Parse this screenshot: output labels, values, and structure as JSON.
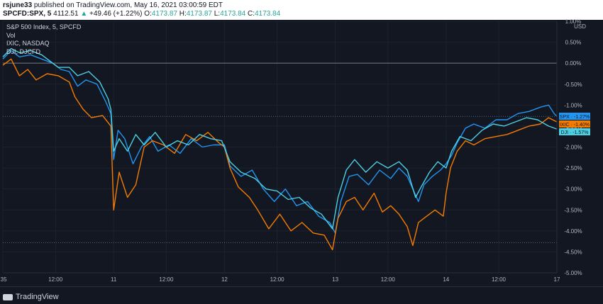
{
  "header": {
    "author": "rsjune33",
    "published": "published on TradingView.com, May 16, 2021 03:00:59 EDT",
    "symbol": "SPCFD:SPX, 5",
    "last": "4112.51",
    "change_arrow": "▲",
    "change": "+49.46 (+1.22%)",
    "o_label": "O:",
    "o": "4173.87",
    "h_label": "H:",
    "h": "4173.87",
    "l_label": "L:",
    "l": "4173.84",
    "c_label": "C:",
    "c": "4173.84"
  },
  "legend": {
    "title": "S&P 500 Index, 5, SPCFD",
    "vol": "Vol",
    "ixic": "IXIC, NASDAQ",
    "dji": "DJI, DJCFD"
  },
  "footer": {
    "brand": "TradingView"
  },
  "colors": {
    "spx": "#2196f3",
    "ixic": "#f57c00",
    "dji": "#4dd0e1",
    "bg": "#131722"
  },
  "chart_data": {
    "type": "line",
    "x_tick_labels": [
      ":35",
      "12:00",
      "11",
      "12:00",
      "12",
      "12:00",
      "13",
      "12:00",
      "14",
      "12:00",
      "17"
    ],
    "x_tick_pos": [
      0,
      0.95,
      2,
      2.95,
      4,
      4.95,
      6,
      6.95,
      8,
      8.95,
      10
    ],
    "y_unit": "USD",
    "y_ticks": [
      "1.00%",
      "0.50%",
      "0.00%",
      "-0.50%",
      "-1.00%",
      "-1.50%",
      "-2.00%",
      "-2.50%",
      "-3.00%",
      "-3.50%",
      "-4.00%",
      "-4.50%",
      "-5.00%"
    ],
    "y_tick_values": [
      1.0,
      0.5,
      0.0,
      -0.5,
      -1.0,
      -1.5,
      -2.0,
      -2.5,
      -3.0,
      -3.5,
      -4.0,
      -4.5,
      -5.0
    ],
    "ylim": [
      -5.0,
      1.0
    ],
    "xlim": [
      0,
      10
    ],
    "reference_lines": [
      0.0,
      -1.27,
      -4.28
    ],
    "series": [
      {
        "name": "SPX",
        "end_label": "SPX · -1.27%",
        "color": "#2196f3",
        "points": [
          [
            0,
            0.1
          ],
          [
            0.15,
            0.3
          ],
          [
            0.3,
            0.15
          ],
          [
            0.5,
            0.2
          ],
          [
            0.7,
            0.1
          ],
          [
            0.9,
            0.0
          ],
          [
            1.05,
            -0.15
          ],
          [
            1.2,
            -0.2
          ],
          [
            1.35,
            -0.55
          ],
          [
            1.5,
            -0.4
          ],
          [
            1.7,
            -0.5
          ],
          [
            1.85,
            -0.9
          ],
          [
            1.95,
            -1.2
          ],
          [
            2.0,
            -2.3
          ],
          [
            2.08,
            -1.6
          ],
          [
            2.2,
            -1.8
          ],
          [
            2.35,
            -2.4
          ],
          [
            2.5,
            -2.0
          ],
          [
            2.65,
            -1.75
          ],
          [
            2.8,
            -2.1
          ],
          [
            3.0,
            -1.95
          ],
          [
            3.2,
            -2.15
          ],
          [
            3.4,
            -1.8
          ],
          [
            3.6,
            -2.0
          ],
          [
            3.8,
            -1.95
          ],
          [
            4.0,
            -1.95
          ],
          [
            4.1,
            -2.45
          ],
          [
            4.3,
            -2.7
          ],
          [
            4.5,
            -2.55
          ],
          [
            4.7,
            -3.0
          ],
          [
            4.9,
            -3.3
          ],
          [
            5.1,
            -3.0
          ],
          [
            5.3,
            -3.4
          ],
          [
            5.5,
            -3.3
          ],
          [
            5.7,
            -3.65
          ],
          [
            5.9,
            -3.8
          ],
          [
            6.0,
            -4.05
          ],
          [
            6.1,
            -3.3
          ],
          [
            6.25,
            -2.7
          ],
          [
            6.4,
            -2.65
          ],
          [
            6.6,
            -2.9
          ],
          [
            6.8,
            -2.55
          ],
          [
            7.0,
            -2.75
          ],
          [
            7.15,
            -2.5
          ],
          [
            7.3,
            -2.7
          ],
          [
            7.4,
            -3.0
          ],
          [
            7.5,
            -3.3
          ],
          [
            7.6,
            -2.9
          ],
          [
            7.75,
            -2.7
          ],
          [
            7.9,
            -2.55
          ],
          [
            8.0,
            -2.4
          ],
          [
            8.1,
            -2.2
          ],
          [
            8.2,
            -1.9
          ],
          [
            8.35,
            -1.55
          ],
          [
            8.5,
            -1.45
          ],
          [
            8.7,
            -1.55
          ],
          [
            8.9,
            -1.35
          ],
          [
            9.1,
            -1.35
          ],
          [
            9.3,
            -1.2
          ],
          [
            9.5,
            -1.15
          ],
          [
            9.7,
            -1.05
          ],
          [
            9.85,
            -1.0
          ],
          [
            9.95,
            -1.2
          ],
          [
            10.0,
            -1.27
          ]
        ]
      },
      {
        "name": "IXIC",
        "end_label": "IXIC · -1.40%",
        "color": "#f57c00",
        "points": [
          [
            0,
            -0.05
          ],
          [
            0.15,
            0.1
          ],
          [
            0.3,
            -0.3
          ],
          [
            0.45,
            -0.15
          ],
          [
            0.6,
            -0.4
          ],
          [
            0.8,
            -0.25
          ],
          [
            1.0,
            -0.3
          ],
          [
            1.2,
            -0.45
          ],
          [
            1.3,
            -0.8
          ],
          [
            1.45,
            -1.1
          ],
          [
            1.6,
            -1.3
          ],
          [
            1.8,
            -1.25
          ],
          [
            1.95,
            -1.5
          ],
          [
            2.0,
            -3.5
          ],
          [
            2.1,
            -2.6
          ],
          [
            2.25,
            -3.2
          ],
          [
            2.4,
            -2.9
          ],
          [
            2.55,
            -2.0
          ],
          [
            2.7,
            -1.85
          ],
          [
            2.9,
            -1.95
          ],
          [
            3.1,
            -2.15
          ],
          [
            3.3,
            -1.7
          ],
          [
            3.5,
            -1.85
          ],
          [
            3.7,
            -1.65
          ],
          [
            3.9,
            -1.9
          ],
          [
            4.0,
            -2.0
          ],
          [
            4.1,
            -2.5
          ],
          [
            4.25,
            -2.95
          ],
          [
            4.45,
            -3.2
          ],
          [
            4.6,
            -3.5
          ],
          [
            4.8,
            -3.95
          ],
          [
            5.0,
            -3.6
          ],
          [
            5.2,
            -4.0
          ],
          [
            5.4,
            -3.8
          ],
          [
            5.6,
            -4.05
          ],
          [
            5.8,
            -4.1
          ],
          [
            5.95,
            -4.45
          ],
          [
            6.05,
            -3.7
          ],
          [
            6.2,
            -3.3
          ],
          [
            6.35,
            -3.2
          ],
          [
            6.5,
            -3.5
          ],
          [
            6.7,
            -3.1
          ],
          [
            6.85,
            -3.55
          ],
          [
            7.0,
            -3.4
          ],
          [
            7.15,
            -3.6
          ],
          [
            7.3,
            -3.9
          ],
          [
            7.4,
            -4.35
          ],
          [
            7.5,
            -3.8
          ],
          [
            7.65,
            -3.65
          ],
          [
            7.8,
            -3.5
          ],
          [
            7.95,
            -3.65
          ],
          [
            8.0,
            -3.1
          ],
          [
            8.08,
            -2.5
          ],
          [
            8.2,
            -2.1
          ],
          [
            8.35,
            -1.85
          ],
          [
            8.5,
            -1.95
          ],
          [
            8.7,
            -1.8
          ],
          [
            8.9,
            -1.75
          ],
          [
            9.1,
            -1.7
          ],
          [
            9.3,
            -1.6
          ],
          [
            9.5,
            -1.5
          ],
          [
            9.7,
            -1.45
          ],
          [
            9.85,
            -1.3
          ],
          [
            10.0,
            -1.4
          ]
        ]
      },
      {
        "name": "DJI",
        "end_label": "DJI · -1.57%",
        "color": "#4dd0e1",
        "points": [
          [
            0,
            0.15
          ],
          [
            0.15,
            0.35
          ],
          [
            0.3,
            0.25
          ],
          [
            0.5,
            0.3
          ],
          [
            0.7,
            0.2
          ],
          [
            0.85,
            0.05
          ],
          [
            1.0,
            -0.1
          ],
          [
            1.2,
            -0.1
          ],
          [
            1.35,
            -0.3
          ],
          [
            1.55,
            -0.2
          ],
          [
            1.75,
            -0.45
          ],
          [
            1.9,
            -0.85
          ],
          [
            1.95,
            -1.1
          ],
          [
            2.0,
            -2.1
          ],
          [
            2.1,
            -1.8
          ],
          [
            2.25,
            -2.1
          ],
          [
            2.4,
            -1.7
          ],
          [
            2.55,
            -1.95
          ],
          [
            2.75,
            -1.65
          ],
          [
            2.95,
            -2.0
          ],
          [
            3.15,
            -1.85
          ],
          [
            3.35,
            -1.95
          ],
          [
            3.55,
            -1.7
          ],
          [
            3.75,
            -1.8
          ],
          [
            3.95,
            -1.85
          ],
          [
            4.1,
            -2.35
          ],
          [
            4.3,
            -2.6
          ],
          [
            4.55,
            -2.75
          ],
          [
            4.75,
            -3.0
          ],
          [
            4.95,
            -3.05
          ],
          [
            5.15,
            -3.25
          ],
          [
            5.35,
            -3.2
          ],
          [
            5.55,
            -3.45
          ],
          [
            5.75,
            -3.6
          ],
          [
            5.95,
            -3.95
          ],
          [
            6.05,
            -3.2
          ],
          [
            6.2,
            -2.55
          ],
          [
            6.35,
            -2.3
          ],
          [
            6.55,
            -2.6
          ],
          [
            6.75,
            -2.35
          ],
          [
            6.95,
            -2.5
          ],
          [
            7.15,
            -2.35
          ],
          [
            7.3,
            -2.55
          ],
          [
            7.45,
            -3.2
          ],
          [
            7.55,
            -2.95
          ],
          [
            7.7,
            -2.6
          ],
          [
            7.85,
            -2.35
          ],
          [
            8.0,
            -2.5
          ],
          [
            8.1,
            -2.1
          ],
          [
            8.25,
            -1.75
          ],
          [
            8.45,
            -1.85
          ],
          [
            8.65,
            -1.6
          ],
          [
            8.85,
            -1.45
          ],
          [
            9.05,
            -1.5
          ],
          [
            9.25,
            -1.4
          ],
          [
            9.45,
            -1.3
          ],
          [
            9.65,
            -1.35
          ],
          [
            9.85,
            -1.5
          ],
          [
            10.0,
            -1.57
          ]
        ]
      }
    ]
  }
}
